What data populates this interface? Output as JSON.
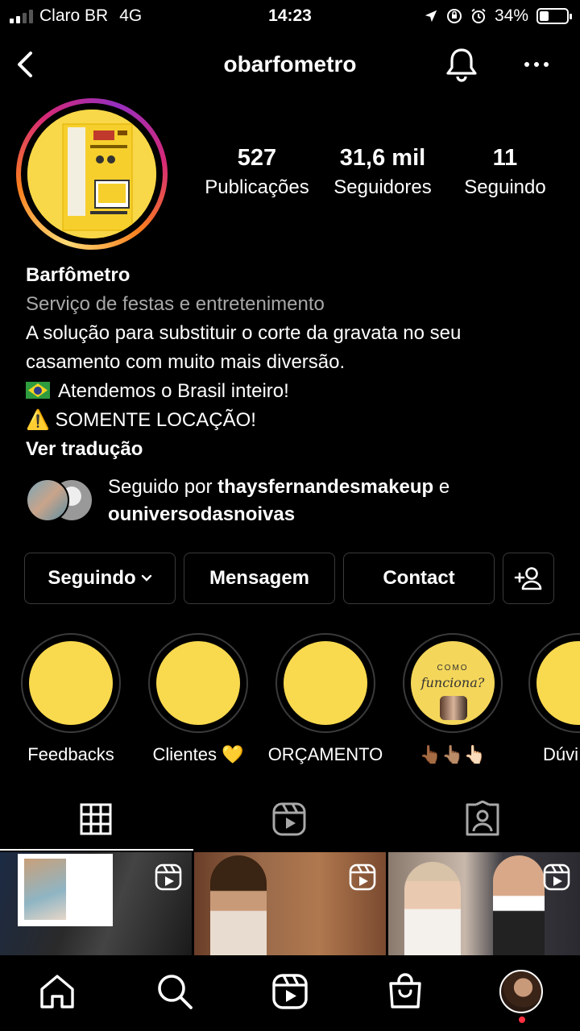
{
  "status_bar": {
    "carrier": "Claro BR",
    "network": "4G",
    "time": "14:23",
    "battery": "34%",
    "battery_level": 0.34,
    "signal_bars": 2
  },
  "header": {
    "back_icon": "chevron-left-icon",
    "username": "obarfometro",
    "notify_icon": "bell-icon",
    "more_icon": "more-dots-icon"
  },
  "profile": {
    "stats": [
      {
        "value": "527",
        "label": "Publicações"
      },
      {
        "value": "31,6 mil",
        "label": "Seguidores"
      },
      {
        "value": "11",
        "label": "Seguindo"
      }
    ],
    "name": "Barfômetro",
    "category": "Serviço de festas e entretenimento",
    "bio_line1": "A solução para substituir o corte da gravata no seu",
    "bio_line2": "casamento com muito mais diversão.",
    "bio_line3": "Atendemos o Brasil inteiro!",
    "bio_line4": "⚠️ SOMENTE LOCAÇÃO!",
    "see_translation": "Ver tradução",
    "followed_by_prefix": "Seguido por",
    "followed_by_user1": "thaysfernandesmakeup",
    "followed_by_joiner": "e",
    "followed_by_user2": "ouniversodasnoivas"
  },
  "actions": {
    "following": "Seguindo",
    "message": "Mensagem",
    "contact": "Contact",
    "add_user_icon": "add-person-icon"
  },
  "highlights": [
    {
      "label": "Feedbacks"
    },
    {
      "label": "Clientes 💛"
    },
    {
      "label": "ORÇAMENTO"
    },
    {
      "label": "👆🏾👆🏽👆🏻",
      "cover_small": "COMO",
      "cover_script": "funciona?"
    },
    {
      "label": "Dúvi"
    }
  ],
  "tabs": {
    "grid_icon": "grid-icon",
    "reels_icon": "reels-icon",
    "tagged_icon": "tagged-person-icon"
  },
  "colors": {
    "background": "#000000",
    "accent_yellow": "#f9d94e",
    "secondary_text": "#a8a8a8",
    "notification_dot": "#ff3040"
  },
  "bottom_nav": [
    "home-icon",
    "search-icon",
    "reels-icon",
    "shop-icon",
    "profile-avatar"
  ]
}
